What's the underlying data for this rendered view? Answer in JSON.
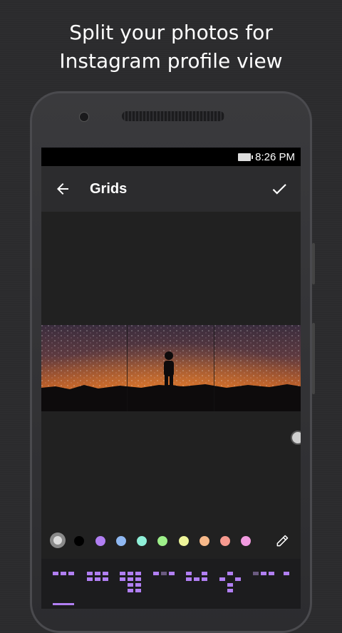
{
  "headline": {
    "line1": "Split your photos for",
    "line2": "Instagram profile view"
  },
  "status_bar": {
    "time": "8:26 PM",
    "battery_icon": "battery-icon"
  },
  "app_bar": {
    "title": "Grids",
    "back_icon": "arrow-left-icon",
    "confirm_icon": "check-icon"
  },
  "colors": {
    "accent": "#b17ff3",
    "app_bar_bg": "#2c2c2e",
    "screen_bg": "#212121",
    "status_bar_bg": "#000000"
  },
  "palette": {
    "selected_index": 0,
    "swatches": [
      "#dddddd",
      "#000000",
      "#b17ff3",
      "#8fb8f2",
      "#8ff0d8",
      "#9ef08a",
      "#eef59a",
      "#f7b98a",
      "#f79a8f",
      "#f29be0"
    ],
    "picker_icon": "eyedropper-icon"
  },
  "layouts": {
    "selected_index": 0,
    "items": [
      "grid-1x3",
      "grid-2x3",
      "grid-3x3",
      "grid-custom-1",
      "grid-custom-2",
      "grid-custom-3",
      "grid-custom-4",
      "grid-custom-5"
    ]
  }
}
